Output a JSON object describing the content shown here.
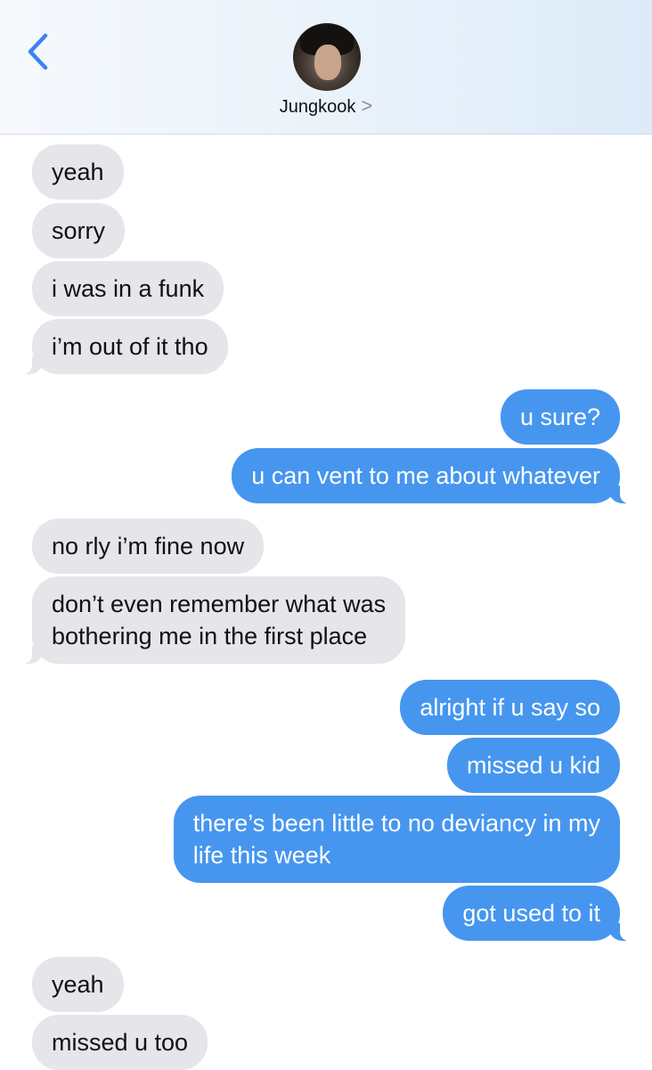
{
  "header": {
    "back_icon": "chevron-left-icon",
    "contact_name": "Jungkook",
    "contact_chevron": ">",
    "accent_color": "#3a82f6"
  },
  "messages": [
    {
      "from": "them",
      "text": "yeah"
    },
    {
      "from": "them",
      "text": "sorry"
    },
    {
      "from": "them",
      "text": "i was in a funk"
    },
    {
      "from": "them",
      "text": "i’m out of it tho"
    },
    {
      "from": "me",
      "text": "u sure?"
    },
    {
      "from": "me",
      "text": "u can vent to me about whatever"
    },
    {
      "from": "them",
      "text": "no rly i’m fine now"
    },
    {
      "from": "them",
      "text": "don’t even remember what was\nbothering me in the first place"
    },
    {
      "from": "me",
      "text": "alright if u say so"
    },
    {
      "from": "me",
      "text": "missed u kid"
    },
    {
      "from": "me",
      "text": "there’s been little to no deviancy in my\nlife this week"
    },
    {
      "from": "me",
      "text": "got used to it"
    },
    {
      "from": "them",
      "text": "yeah"
    },
    {
      "from": "them",
      "text": "missed u too"
    }
  ],
  "colors": {
    "incoming_bubble": "#e5e5ea",
    "outgoing_bubble": "#4696ef"
  }
}
